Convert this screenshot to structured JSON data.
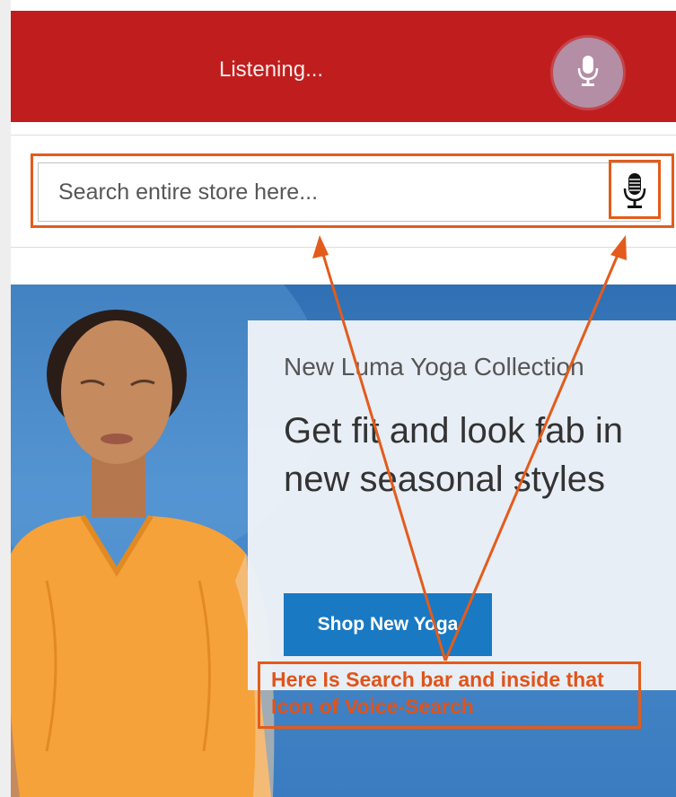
{
  "voice_header": {
    "status_text": "Listening...",
    "mic_icon": "microphone-icon",
    "background_color": "#c01e1e",
    "mic_circle_color": "#b48ea4"
  },
  "search": {
    "placeholder": "Search entire store here...",
    "value": "",
    "voice_icon": "microphone-icon"
  },
  "hero": {
    "subtitle": "New Luma Yoga Collection",
    "headline": "Get fit and look fab in new seasonal styles",
    "button_label": "Shop New Yoga",
    "button_color": "#1979c3"
  },
  "annotation": {
    "note": "Here Is Search bar and inside that Icon of Voice-Search",
    "color": "#e35c1b"
  }
}
